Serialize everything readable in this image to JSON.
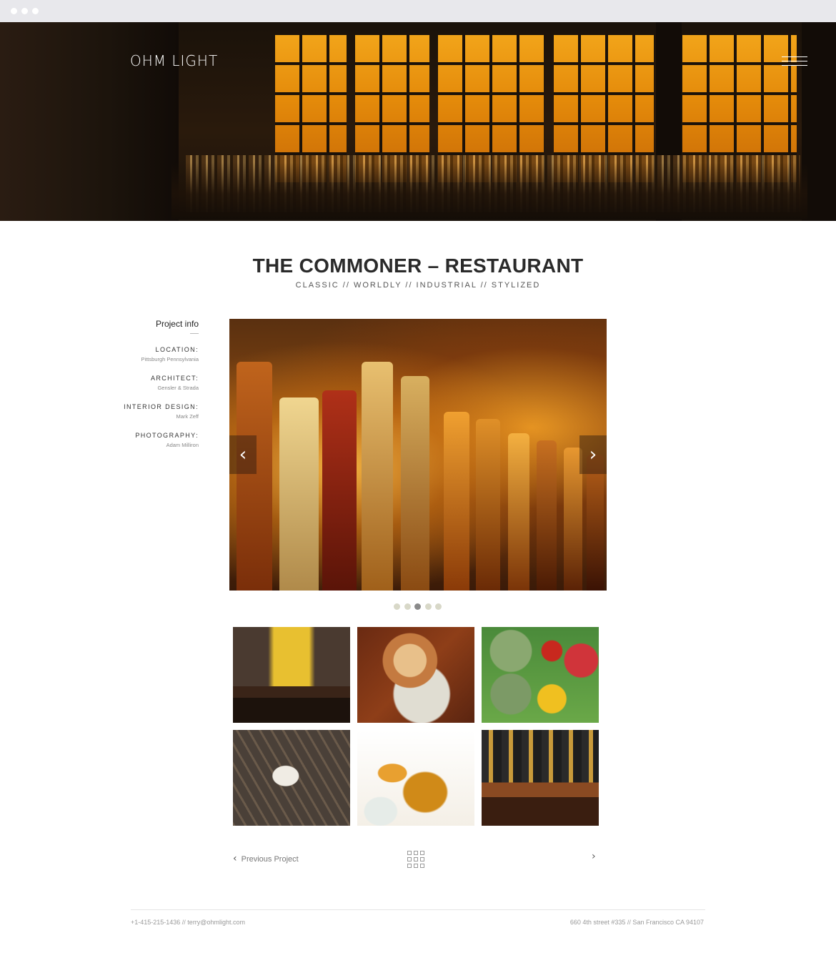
{
  "header": {
    "brand": "OHM LIGHT",
    "menu_icon": "hamburger-menu-icon"
  },
  "project": {
    "title": "THE COMMONER – RESTAURANT",
    "tagline": "CLASSIC // WORLDLY // INDUSTRIAL // STYLIZED"
  },
  "info": {
    "heading": "Project info",
    "items": [
      {
        "label": "LOCATION:",
        "value": "Pittsburgh Pennsylvania"
      },
      {
        "label": "ARCHITECT:",
        "value": "Gensler & Strada"
      },
      {
        "label": "INTERIOR DESIGN:",
        "value": "Mark Zeff"
      },
      {
        "label": "PHOTOGRAPHY:",
        "value": "Adam Milliron"
      }
    ]
  },
  "slider": {
    "prev_icon": "chevron-left-icon",
    "next_icon": "chevron-right-icon",
    "prev_glyph": "‹",
    "next_glyph": "›",
    "total_slides": 5,
    "active_slide": 3,
    "dot_color": "#d8d8c8",
    "active_dot_color": "#8a8a8a"
  },
  "gallery": {
    "count": 6
  },
  "project_nav": {
    "prev_label": "Previous Project",
    "prev_glyph": "‹",
    "next_glyph": "›",
    "grid_icon": "grid-icon"
  },
  "footer": {
    "contact": "+1-415-215-1436 // terry@ohmlight.com",
    "address": "660 4th street #335 // San Francisco CA 94107"
  }
}
